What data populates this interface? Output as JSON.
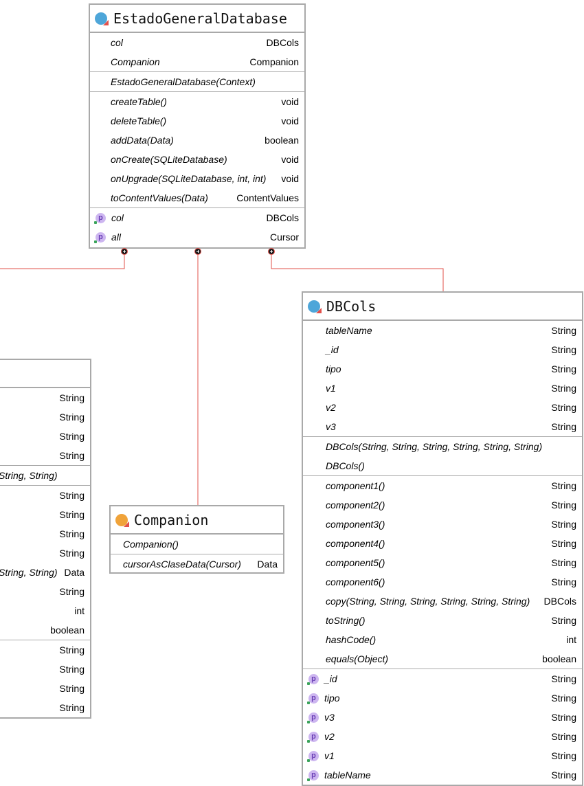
{
  "estado": {
    "title": "EstadoGeneralDatabase",
    "fields": [
      {
        "name": "col",
        "type": "DBCols"
      },
      {
        "name": "Companion",
        "type": "Companion"
      }
    ],
    "constructors": [
      {
        "name": "EstadoGeneralDatabase(Context)",
        "type": ""
      }
    ],
    "methods": [
      {
        "name": "createTable()",
        "type": "void"
      },
      {
        "name": "deleteTable()",
        "type": "void"
      },
      {
        "name": "addData(Data)",
        "type": "boolean"
      },
      {
        "name": "onCreate(SQLiteDatabase)",
        "type": "void"
      },
      {
        "name": "onUpgrade(SQLiteDatabase, int, int)",
        "type": "void"
      },
      {
        "name": "toContentValues(Data)",
        "type": "ContentValues"
      }
    ],
    "properties": [
      {
        "name": "col",
        "type": "DBCols"
      },
      {
        "name": "all",
        "type": "Cursor"
      }
    ]
  },
  "data_class": {
    "fields": [
      {
        "type": "String"
      },
      {
        "type": "String"
      },
      {
        "type": "String"
      },
      {
        "type": "String"
      }
    ],
    "constructor_tail": "String, String)",
    "methods": [
      {
        "name": "",
        "type": "String"
      },
      {
        "name": "",
        "type": "String"
      },
      {
        "name": "",
        "type": "String"
      },
      {
        "name": "",
        "type": "String"
      },
      {
        "name": "String, String)",
        "type": "Data"
      },
      {
        "name": "",
        "type": "String"
      },
      {
        "name": "",
        "type": "int"
      },
      {
        "name": "",
        "type": "boolean"
      }
    ],
    "properties": [
      {
        "type": "String"
      },
      {
        "type": "String"
      },
      {
        "type": "String"
      },
      {
        "type": "String"
      }
    ]
  },
  "companion": {
    "title": "Companion",
    "constructors": [
      {
        "name": "Companion()",
        "type": ""
      }
    ],
    "methods": [
      {
        "name": "cursorAsClaseData(Cursor)",
        "type": "Data"
      }
    ]
  },
  "dbcols": {
    "title": "DBCols",
    "fields": [
      {
        "name": "tableName",
        "type": "String"
      },
      {
        "name": "_id",
        "type": "String"
      },
      {
        "name": "tipo",
        "type": "String"
      },
      {
        "name": "v1",
        "type": "String"
      },
      {
        "name": "v2",
        "type": "String"
      },
      {
        "name": "v3",
        "type": "String"
      }
    ],
    "constructors": [
      {
        "name": "DBCols(String, String, String, String, String, String)",
        "type": ""
      },
      {
        "name": "DBCols()",
        "type": ""
      }
    ],
    "methods": [
      {
        "name": "component1()",
        "type": "String"
      },
      {
        "name": "component2()",
        "type": "String"
      },
      {
        "name": "component3()",
        "type": "String"
      },
      {
        "name": "component4()",
        "type": "String"
      },
      {
        "name": "component5()",
        "type": "String"
      },
      {
        "name": "component6()",
        "type": "String"
      },
      {
        "name": "copy(String, String, String, String, String, String)",
        "type": "DBCols"
      },
      {
        "name": "toString()",
        "type": "String"
      },
      {
        "name": "hashCode()",
        "type": "int"
      },
      {
        "name": "equals(Object)",
        "type": "boolean"
      }
    ],
    "properties": [
      {
        "name": "_id",
        "type": "String"
      },
      {
        "name": "tipo",
        "type": "String"
      },
      {
        "name": "v3",
        "type": "String"
      },
      {
        "name": "v2",
        "type": "String"
      },
      {
        "name": "v1",
        "type": "String"
      },
      {
        "name": "tableName",
        "type": "String"
      }
    ]
  },
  "icons": {
    "class_icon": "kotlin-class-icon",
    "property_icon": "property-icon",
    "connector_icon": "nested-class-connector-icon",
    "property_glyph": "p"
  },
  "colors": {
    "connector_line": "#e2504a",
    "border": "#a9a9a9",
    "class_icon_blue": "#4ea6d9",
    "class_icon_orange": "#f0a33a",
    "property_icon": "#cdb6f0"
  }
}
